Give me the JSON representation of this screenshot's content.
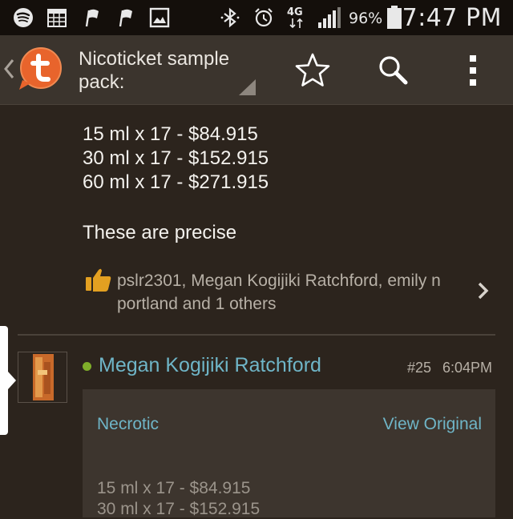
{
  "status_bar": {
    "time": "7:47 PM",
    "battery_percent": "96%",
    "network": "4G",
    "icons": [
      "spotify-icon",
      "calendar-icon",
      "flag-icon",
      "flag-icon",
      "gallery-icon",
      "bluetooth-icon",
      "alarm-icon",
      "network-4g-icon",
      "signal-icon",
      "battery-icon"
    ]
  },
  "action_bar": {
    "title": "Nicoticket sample pack:",
    "icons": [
      "back-chevron-icon",
      "tapatalk-logo-icon",
      "dropdown-corner-icon",
      "star-icon",
      "search-icon",
      "overflow-menu-icon"
    ]
  },
  "post1": {
    "lines": [
      "15 ml x 17 - $84.915",
      "30 ml x 17 - $152.915",
      "60 ml x 17 - $271.915"
    ],
    "remark": "These are precise",
    "likes": {
      "text": "pslr2301, Megan Kogijiki Ratchford, emily n portland and 1 others",
      "icons": [
        "thumbs-up-icon",
        "chevron-right-icon"
      ]
    }
  },
  "post2": {
    "author": "Megan Kogijiki Ratchford",
    "number": "#25",
    "time": "6:04PM",
    "online_color": "#7fae2a",
    "quote": {
      "author": "Necrotic",
      "view_original": "View Original",
      "lines": [
        "15 ml x 17 - $84.915",
        "30 ml x 17 - $152.915"
      ]
    }
  },
  "colors": {
    "background": "#2c241d",
    "action_bar": "#3b342d",
    "link": "#6fb5c7",
    "brand": "#e8642c"
  }
}
